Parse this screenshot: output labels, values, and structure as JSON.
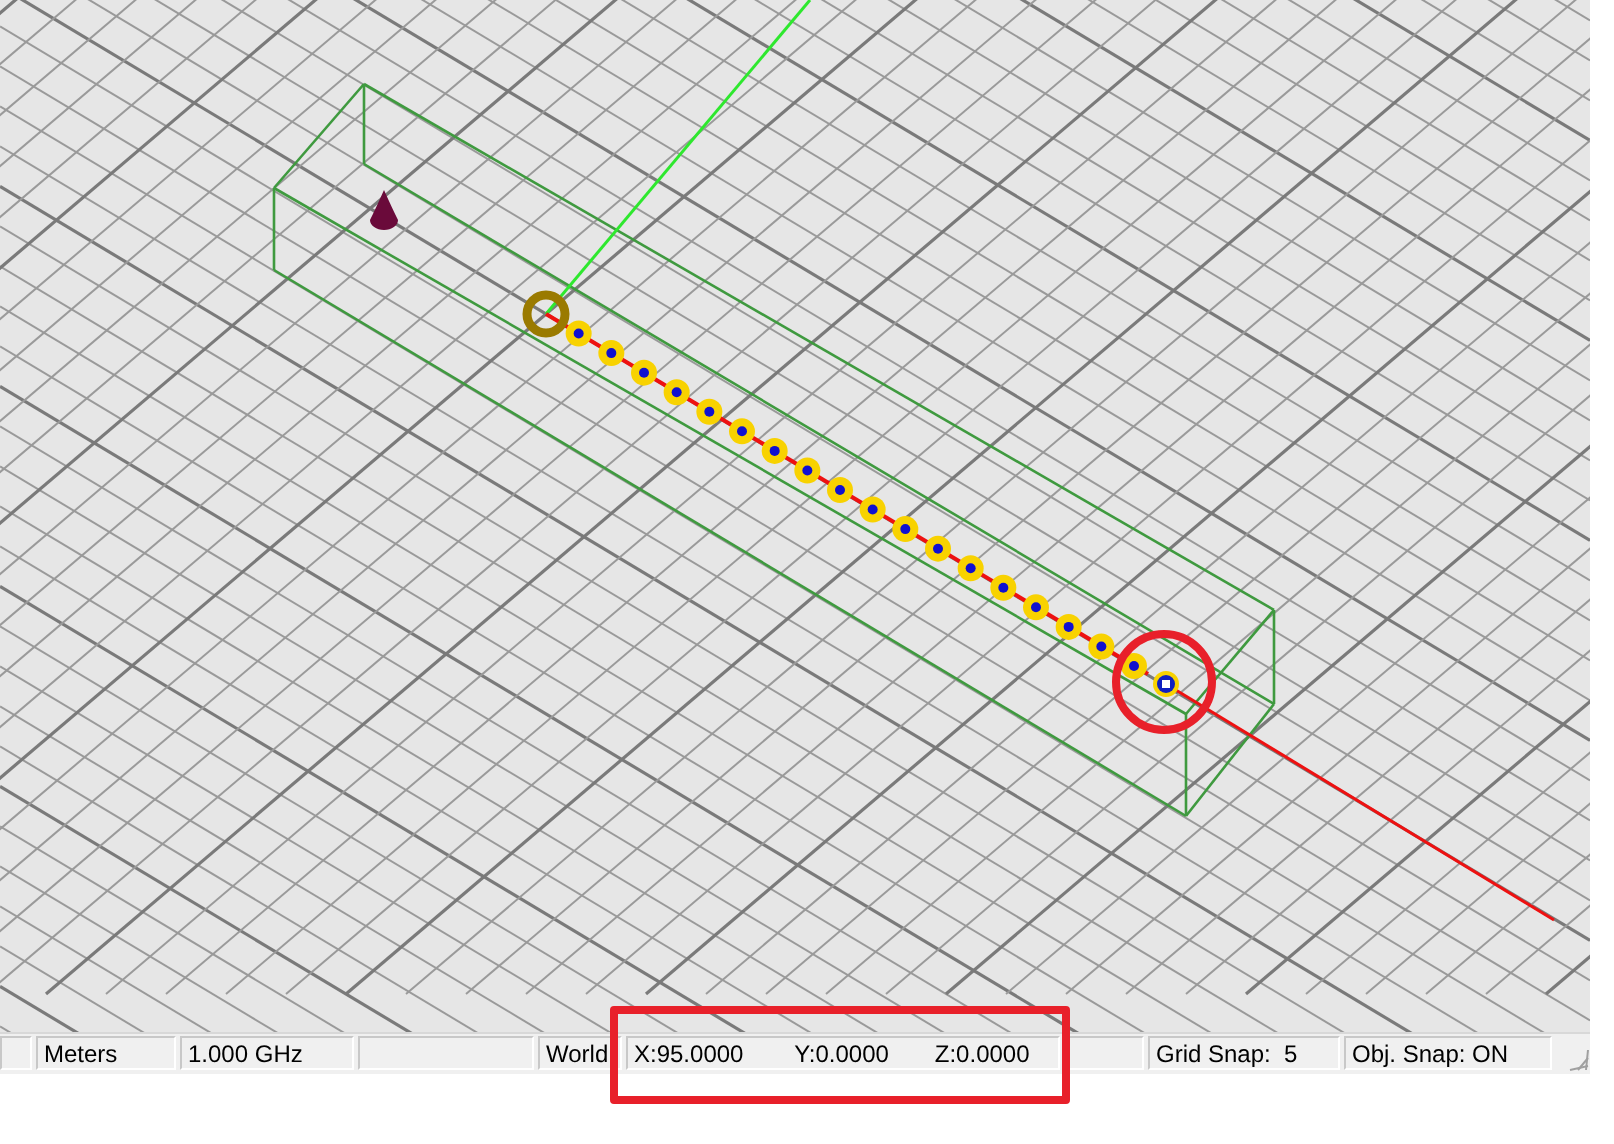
{
  "status_bar": {
    "panels": [
      {
        "kind": "blank"
      },
      {
        "kind": "text",
        "text": "Meters"
      },
      {
        "kind": "text",
        "text": "1.000 GHz"
      },
      {
        "kind": "blank"
      },
      {
        "kind": "text",
        "text": "World"
      },
      {
        "kind": "coords",
        "x": "X:95.0000",
        "y": "Y:0.0000",
        "z": "Z:0.0000"
      },
      {
        "kind": "blank"
      },
      {
        "kind": "text",
        "text": "Grid Snap:  5"
      },
      {
        "kind": "text",
        "text": "Obj. Snap: ON"
      }
    ]
  }
}
